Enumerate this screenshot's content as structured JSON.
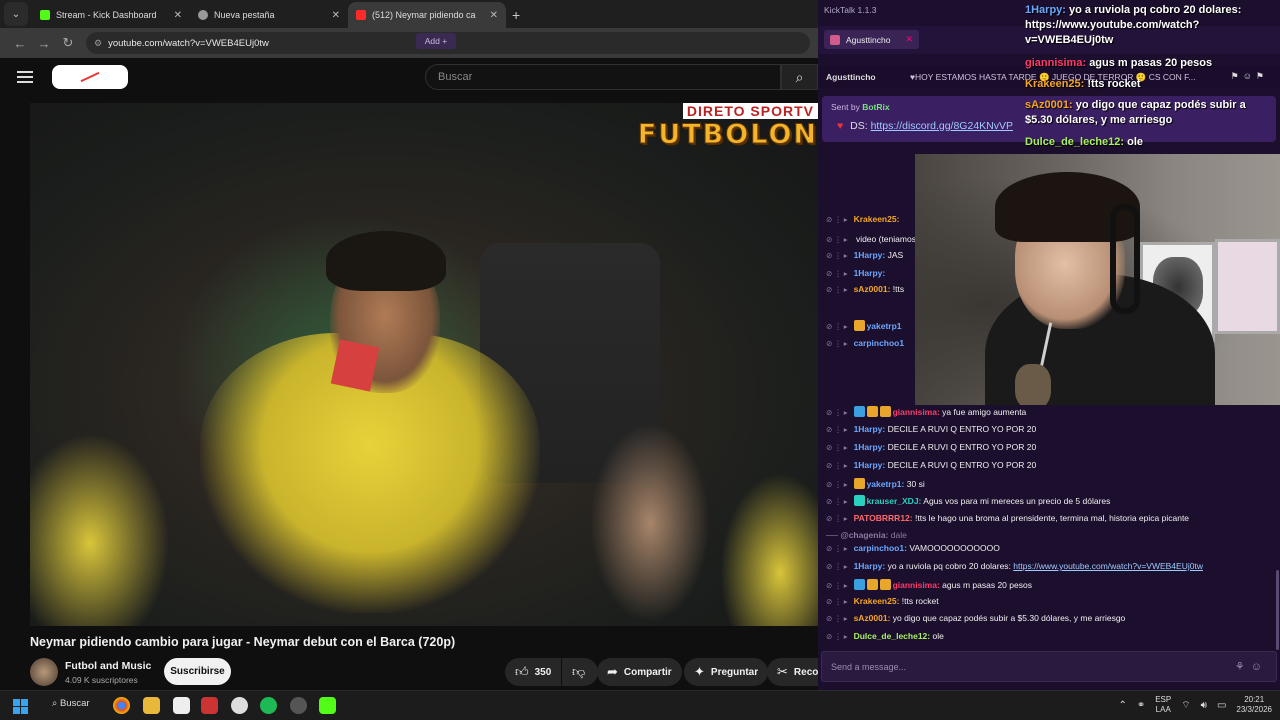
{
  "browser": {
    "tabs": [
      {
        "title": "Stream - Kick Dashboard",
        "favicon_color": "#53fc18",
        "close": "✕"
      },
      {
        "title": "Nueva pestaña",
        "favicon_color": "#999999",
        "close": "✕"
      },
      {
        "title": "(512) Neymar pidiendo ca",
        "favicon_color": "#ff2a2a",
        "close": "✕"
      }
    ],
    "new_tab": "+",
    "url": "youtube.com/watch?v=VWEB4EUj0tw"
  },
  "youtube": {
    "search_placeholder": "Buscar",
    "video": {
      "broadcaster_top": "DIRETO SPORTV",
      "broadcaster_main": "FUTBOLON"
    },
    "title": "Neymar pidiendo cambio para jugar - Neymar debut con el Barca (720p)",
    "channel": {
      "name": "Futbol and Music",
      "subscribers": "4.09 K suscriptores"
    },
    "subscribe_label": "Suscribirse",
    "actions": {
      "likes": "350",
      "share": "Compartir",
      "ask": "Preguntar",
      "clip": "Reco"
    }
  },
  "kicktalk": {
    "app_title": "KickTalk 1.1.3",
    "tab_label": "Agusttincho",
    "tab_close": "✕",
    "add_label": "Add +",
    "stream_user": "Agusttincho",
    "stream_title": "♥HOY ESTAMOS HASTA TARDE 🙂 JUEGO DE TERROR 🙂 CS CON F...",
    "pinned": {
      "sent_by_label": "Sent by",
      "sent_by_user": "BotRix",
      "prefix": "DS:",
      "link": "https://discord.gg/8G24KNvVP"
    },
    "messages": [
      {
        "user": "Krakeen25:",
        "text": "",
        "color": "#f5a623",
        "badges": []
      },
      {
        "user": "",
        "text": "video (teniamos 13 añ",
        "color": "#ffffff",
        "badges": []
      },
      {
        "user": "1Harpy:",
        "text": "JAS",
        "color": "#6aa8ff",
        "badges": []
      },
      {
        "user": "1Harpy:",
        "text": "",
        "color": "#6aa8ff",
        "badges": []
      },
      {
        "user": "sAz0001:",
        "text": "!tts",
        "color": "#f5a623",
        "badges": []
      },
      {
        "user": "yaketrp1",
        "text": "",
        "color": "#6aa8ff",
        "badges": [
          "gold"
        ]
      },
      {
        "user": "carpinchoo1",
        "text": "",
        "color": "#6aa8ff",
        "badges": []
      },
      {
        "user": "giannisima:",
        "text": "ya fue amigo aumenta",
        "color": "#ff3b6b",
        "badges": [
          "blue",
          "gold",
          "gold"
        ]
      },
      {
        "user": "1Harpy:",
        "text": "DECILE A RUVI Q ENTRO YO POR 20",
        "color": "#6aa8ff",
        "badges": []
      },
      {
        "user": "1Harpy:",
        "text": "DECILE A RUVI Q ENTRO YO POR 20",
        "color": "#6aa8ff",
        "badges": []
      },
      {
        "user": "1Harpy:",
        "text": "DECILE A RUVI Q ENTRO YO POR 20",
        "color": "#6aa8ff",
        "badges": []
      },
      {
        "user": "yaketrp1:",
        "text": "30 si",
        "color": "#6aa8ff",
        "badges": [
          "gold"
        ]
      },
      {
        "user": "krauser_XDJ:",
        "text": "Agus vos para mi mereces un precio de 5 dólares",
        "color": "#2ad0c0",
        "badges": [
          "teal"
        ]
      },
      {
        "user": "PATOBRRR12:",
        "text": "!tts le hago una broma al prensidente, termina mal, historia epica picante",
        "color": "#ff6a6a",
        "badges": []
      },
      {
        "user": "@chagenia:",
        "text": "dale",
        "color": "#8a7aa0",
        "badges": [],
        "system": true
      },
      {
        "user": "carpinchoo1:",
        "text": "VAMOOOOOOOOOOO",
        "color": "#6aa8ff",
        "badges": []
      },
      {
        "user": "1Harpy:",
        "text": "yo a ruviola pq cobro 20 dolares: ",
        "link": "https://www.youtube.com/watch?v=VWEB4EUj0tw",
        "color": "#6aa8ff",
        "badges": []
      },
      {
        "user": "giannisima:",
        "text": "agus m pasas 20 pesos",
        "color": "#ff3b6b",
        "badges": [
          "blue",
          "gold",
          "gold"
        ]
      },
      {
        "user": "Krakeen25:",
        "text": "!tts rocket",
        "color": "#f5a623",
        "badges": []
      },
      {
        "user": "sAz0001:",
        "text": "yo digo que capaz podés subir a $5.30 dólares, y me arriesgo",
        "color": "#f5a623",
        "badges": []
      },
      {
        "user": "Dulce_de_leche12:",
        "text": "ole",
        "color": "#a8f060",
        "badges": []
      }
    ],
    "input_placeholder": "Send a message..."
  },
  "overlay_chat": [
    {
      "user": "1Harpy:",
      "text": "yo a ruviola pq cobro 20 dolares: https://www.youtube.com/watch?v=VWEB4EUj0tw",
      "color": "#6aa8ff"
    },
    {
      "user": "giannisima:",
      "text": "agus m pasas 20 pesos",
      "color": "#ff3b6b"
    },
    {
      "user": "Krakeen25:",
      "text": "!tts rocket",
      "color": "#f5a623"
    },
    {
      "user": "sAz0001:",
      "text": "yo digo que capaz podés subir a $5.30 dólares, y me arriesgo",
      "color": "#f5a623"
    },
    {
      "user": "Dulce_de_leche12:",
      "text": "ole",
      "color": "#a8f060"
    }
  ],
  "taskbar": {
    "search_label": "Buscar",
    "lang_top": "ESP",
    "lang_bottom": "LAA",
    "time": "20:21",
    "date": "23/3/2026"
  }
}
